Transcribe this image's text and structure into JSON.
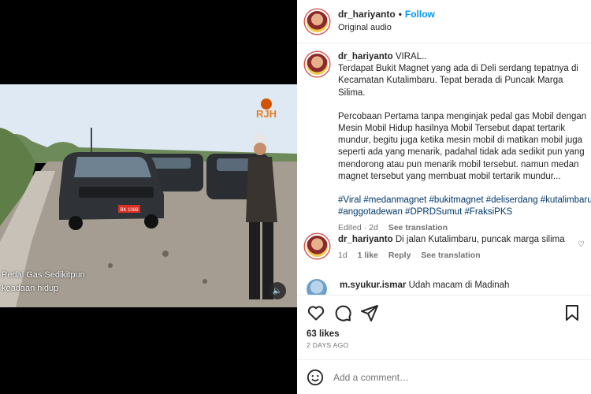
{
  "video": {
    "caption_line1": "Pedal Gas Sedikitpun",
    "caption_line2": "keadaan hidup",
    "plate": "BK 1089",
    "logo_text": "RJH",
    "mute_icon": "speaker-icon"
  },
  "header": {
    "username": "dr_hariyanto",
    "separator": "•",
    "follow_label": "Follow",
    "audio_label": "Original audio"
  },
  "post": {
    "username": "dr_hariyanto",
    "line1": "VIRAL..",
    "para1": "Terdapat Bukit Magnet yang ada di Deli serdang tepatnya di Kecamatan Kutalimbaru. Tepat berada di Puncak Marga Silima.",
    "para2": "Percobaan Pertama tanpa menginjak pedal gas Mobil dengan Mesin Mobil Hidup hasilnya Mobil Tersebut dapat tertarik mundur, begitu juga ketika mesin mobil di matikan mobil juga seperti ada yang menarik, padahal tidak ada sedikit pun yang mendorong atau pun menarik mobil tersebut. namun medan magnet tersebut yang membuat mobil tertarik mundur...",
    "tags": "#Viral #medanmagnet #bukitmagnet #deliserdang #kutalimbaru #anggotadewan #DPRDSumut #FraksiPKS",
    "edited": "Edited · 2d",
    "see_translation": "See translation"
  },
  "comments": [
    {
      "username": "dr_hariyanto",
      "text": "Di jalan Kutalimbaru, puncak marga silima",
      "age": "1d",
      "likes": "1 like",
      "reply": "Reply",
      "see_translation": "See translation"
    },
    {
      "username": "m.syukur.ismar",
      "text": "Udah macam di Madinah"
    }
  ],
  "actions": {
    "likes": "63 likes",
    "date": "2 DAYS AGO",
    "add_comment_placeholder": "Add a comment…"
  },
  "colors": {
    "follow": "#0095f6",
    "hashtag": "#00376b",
    "secondary_text": "#737373",
    "border": "#efefef"
  }
}
